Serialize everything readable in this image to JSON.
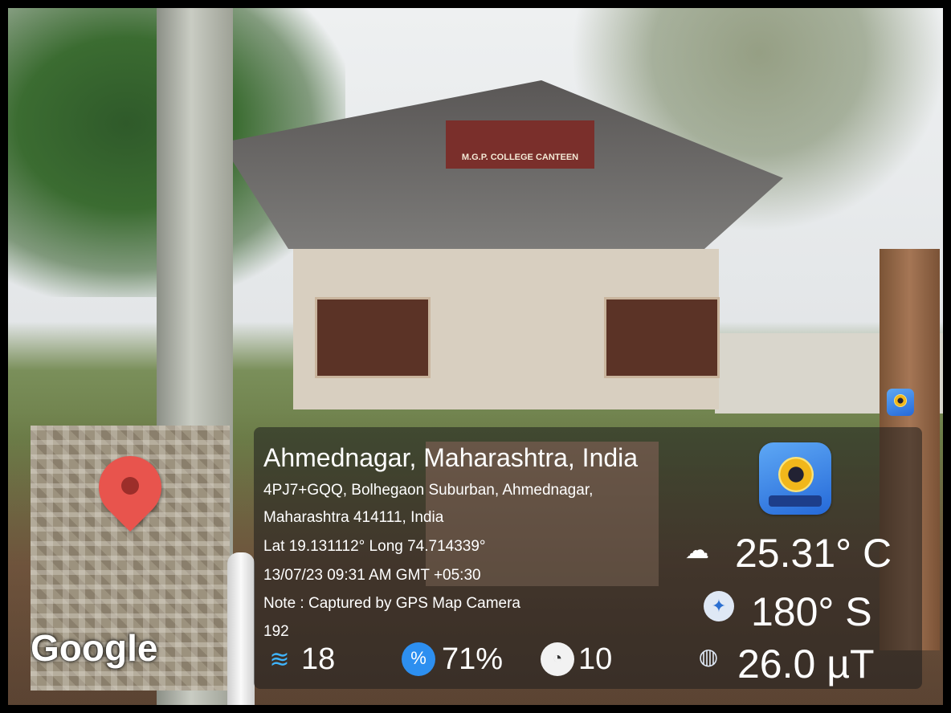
{
  "scene": {
    "canteen_sign": "M.G.P. COLLEGE CANTEEN"
  },
  "map": {
    "logo_text": "Google"
  },
  "location": {
    "city_line": "Ahmednagar, Maharashtra, India",
    "address_line1": "4PJ7+GQQ, Bolhegaon Suburban, Ahmednagar,",
    "address_line2": "Maharashtra 414111, India",
    "coordinates": "Lat 19.131112° Long 74.714339°",
    "datetime": "13/07/23 09:31 AM GMT +05:30",
    "note": "Note : Captured by GPS Map Camera",
    "altitude_partial": "192"
  },
  "sensors": {
    "temperature": "25.31° C",
    "direction": "180° S",
    "magnetic": "26.0 µT",
    "wind": "18",
    "humidity": "71%",
    "pressure": "10"
  },
  "icons": {
    "weather": "cloud-icon",
    "compass": "compass-icon",
    "magnet": "magnet-icon",
    "wind": "wind-icon",
    "humidity": "humidity-icon",
    "pressure": "gauge-icon",
    "app": "gps-map-camera-app-icon"
  }
}
